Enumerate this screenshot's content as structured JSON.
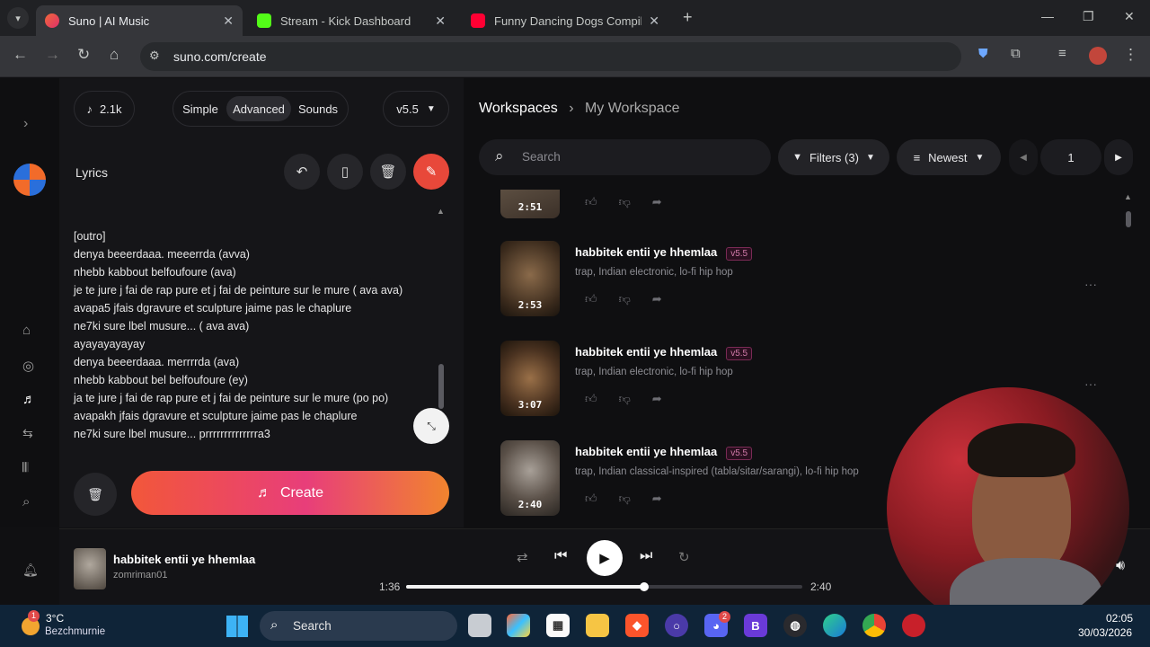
{
  "browser": {
    "tabs": [
      {
        "title": "Suno | AI Music",
        "color": "#f0683a"
      },
      {
        "title": "Stream - Kick Dashboard",
        "color": "#53fc18"
      },
      {
        "title": "Funny Dancing Dogs Compilati",
        "color": "#ff0033"
      }
    ],
    "url": "suno.com/create"
  },
  "create_panel": {
    "credits": "2.1k",
    "modes": [
      "Simple",
      "Advanced",
      "Sounds"
    ],
    "active_mode": "Advanced",
    "model": "v5.5",
    "lyrics_label": "Lyrics",
    "lyrics_lines": [
      "[outro]",
      "denya beeerdaaa. meeerrda (avva)",
      "nhebb kabbout belfoufoure (ava)",
      "je te jure j fai  de rap pure et j fai de peinture  sur le mure ( ava ava)",
      "avapa5 jfais dgravure et sculpture  jaime pas le chaplure",
      "ne7ki sure lbel musure...  ( ava ava)",
      "ayayayayayay",
      "denya beeerdaaa. merrrrda (ava)",
      "nhebb kabbout bel  belfoufoure (ey)",
      "ja te jure j fai  de rap pure et j fai de peinture  sur le mure (po po)",
      "avapakh jfais dgravure et sculpture  jaime pas le chaplure",
      "ne7ki sure lbel musure...  prrrrrrrrrrrrrra3"
    ],
    "create_label": "Create"
  },
  "workspace": {
    "breadcrumb_root": "Workspaces",
    "breadcrumb_current": "My Workspace",
    "search_placeholder": "Search",
    "filters_label": "Filters (3)",
    "sort_label": "Newest",
    "page": "1",
    "partial_song_duration": "2:51",
    "songs": [
      {
        "title": "habbitek entii ye hhemlaa",
        "version": "v5.5",
        "tags": "trap, Indian electronic, lo-fi hip hop",
        "duration": "2:53"
      },
      {
        "title": "habbitek entii ye hhemlaa",
        "version": "v5.5",
        "tags": "trap, Indian electronic, lo-fi hip hop",
        "duration": "3:07"
      },
      {
        "title": "habbitek entii ye hhemlaa",
        "version": "v5.5",
        "tags": "trap, Indian classical-inspired (tabla/sitar/sarangi), lo-fi hip hop",
        "duration": "2:40"
      }
    ]
  },
  "player": {
    "title": "habbitek entii ye hhemlaa",
    "artist": "zomriman01",
    "elapsed": "1:36",
    "total": "2:40",
    "progress": 0.6
  },
  "taskbar": {
    "weather_temp": "3°C",
    "weather_place": "Bezchmurnie",
    "search_label": "Search",
    "time": "02:05",
    "date": "30/03/2026",
    "weather_badge": "1",
    "discord_badge": "2"
  }
}
